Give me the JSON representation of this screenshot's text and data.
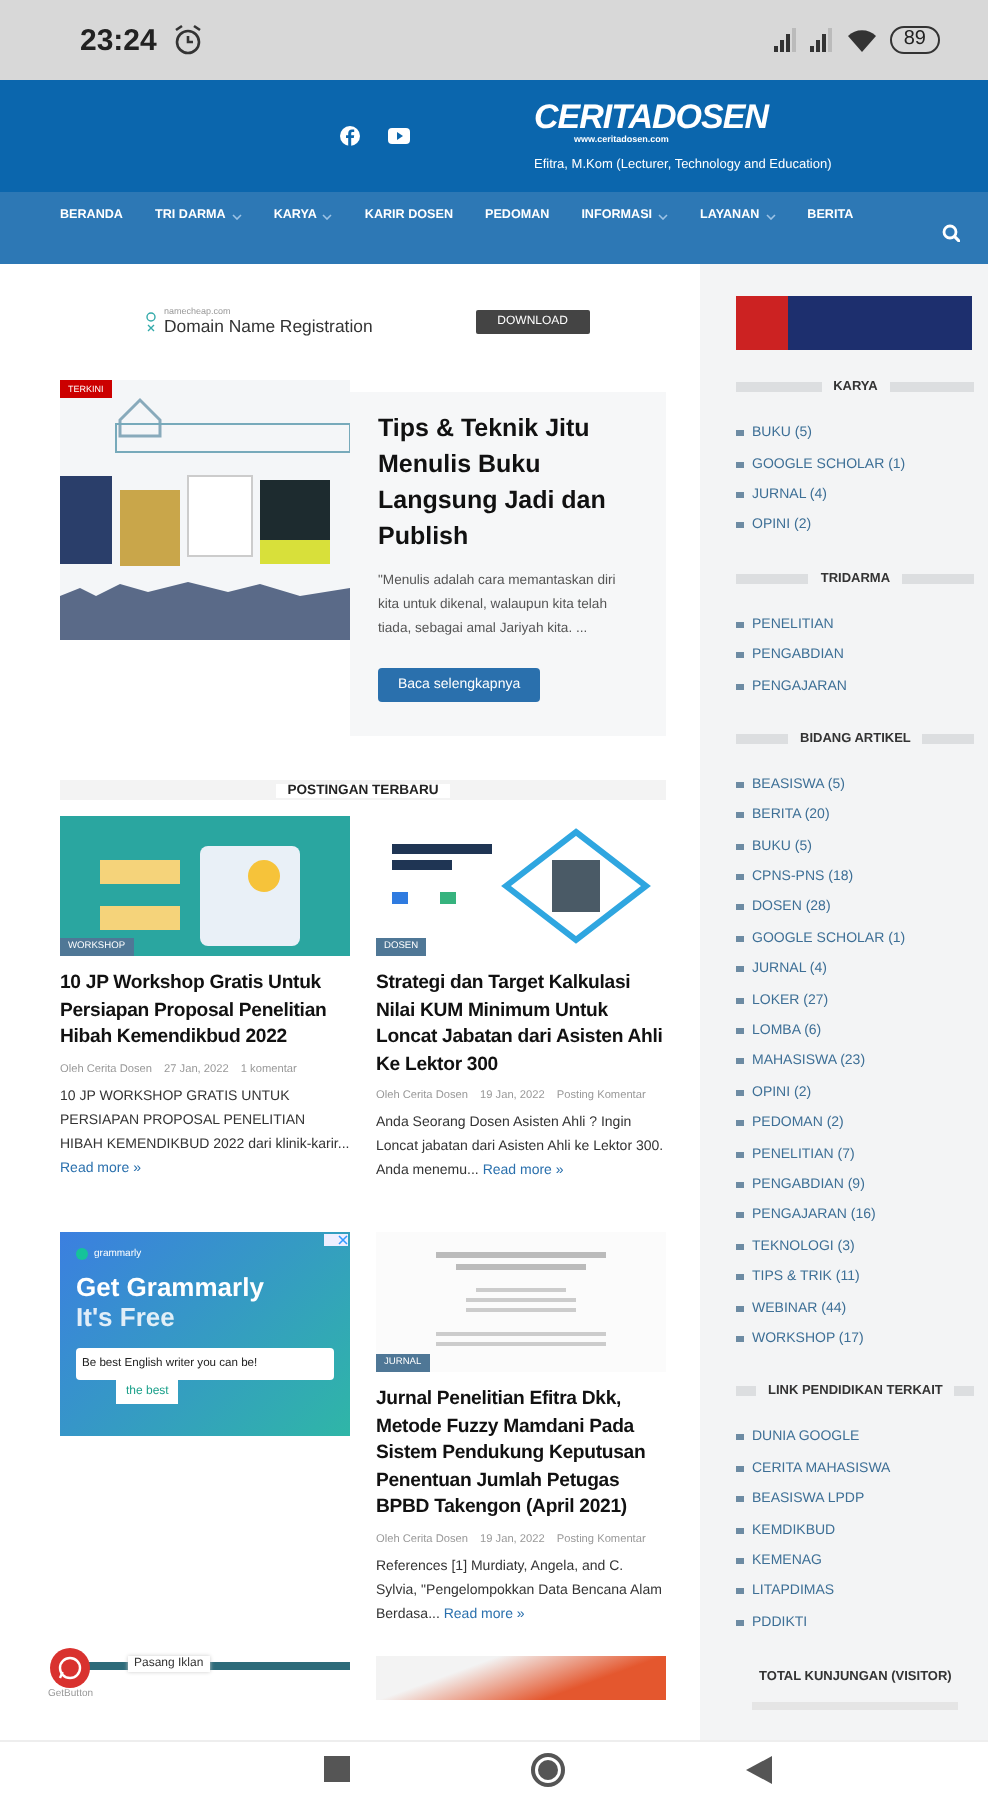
{
  "status_bar": {
    "time": "23:24",
    "battery": "89"
  },
  "header": {
    "logo": "CERITADOSEN",
    "logo_url": "www.ceritadosen.com",
    "tagline": "Efitra, M.Kom (Lecturer, Technology and Education)"
  },
  "nav": [
    {
      "label": "BERANDA",
      "dropdown": false
    },
    {
      "label": "TRI DARMA",
      "dropdown": true
    },
    {
      "label": "KARYA",
      "dropdown": true
    },
    {
      "label": "KARIR DOSEN",
      "dropdown": false
    },
    {
      "label": "PEDOMAN",
      "dropdown": false
    },
    {
      "label": "INFORMASI",
      "dropdown": true
    },
    {
      "label": "LAYANAN",
      "dropdown": true
    },
    {
      "label": "BERITA",
      "dropdown": false
    }
  ],
  "ad": {
    "source": "namecheap.com",
    "title": "Domain Name Registration",
    "button": "DOWNLOAD"
  },
  "featured": {
    "badge": "TERKINI",
    "title": "Tips & Teknik Jitu Menulis Buku Langsung Jadi dan Publish",
    "excerpt": "\"Menulis adalah cara memantaskan diri kita untuk dikenal, walaupun kita telah tiada, sebagai amal Jariyah kita. ...",
    "button": "Baca selengkapnya"
  },
  "section_title": "POSTINGAN TERBARU",
  "posts": [
    {
      "kind": "post",
      "category": "WORKSHOP",
      "title": "10 JP Workshop Gratis Untuk Persiapan Proposal Penelitian Hibah Kemendikbud 2022",
      "author": "Oleh Cerita Dosen",
      "date": "27 Jan, 2022",
      "comments": "1 komentar",
      "excerpt": "10 JP WORKSHOP GRATIS UNTUK PERSIAPAN PROPOSAL PENELITIAN HIBAH KEMENDIKBUD 2022 dari klinik-karir...",
      "read_more": "Read more »"
    },
    {
      "kind": "post",
      "category": "DOSEN",
      "title": "Strategi dan Target Kalkulasi Nilai KUM Minimum Untuk Loncat Jabatan dari Asisten Ahli Ke Lektor 300",
      "author": "Oleh Cerita Dosen",
      "date": "19 Jan, 2022",
      "comments": "Posting Komentar",
      "excerpt": "Anda Seorang Dosen Asisten Ahli ? Ingin Loncat jabatan dari Asisten Ahli ke Lektor 300. Anda menemu...",
      "read_more": "Read more »"
    },
    {
      "kind": "ad",
      "brand": "grammarly",
      "headline": "Get Grammarly",
      "subline": "It's Free",
      "sentence": "Be best English writer you can be!",
      "suggestion": "the best"
    },
    {
      "kind": "post",
      "category": "JURNAL",
      "title": "Jurnal Penelitian Efitra Dkk, Metode Fuzzy Mamdani Pada Sistem Pendukung Keputusan Penentuan Jumlah Petugas BPBD Takengon (April 2021)",
      "author": "Oleh Cerita Dosen",
      "date": "19 Jan, 2022",
      "comments": "Posting Komentar",
      "excerpt": "References [1] Murdiaty, Angela, and C. Sylvia, \"Pengelompokkan Data Bencana Alam Berdasa...",
      "read_more": "Read more »"
    }
  ],
  "chat_widget": {
    "bubble": "Pasang Iklan",
    "caption": "GetButton"
  },
  "sidebar": {
    "widgets": [
      {
        "title": "KARYA",
        "items": [
          "BUKU (5)",
          "GOOGLE SCHOLAR (1)",
          "JURNAL (4)",
          "OPINI (2)"
        ]
      },
      {
        "title": "TRIDARMA",
        "items": [
          "PENELITIAN",
          "PENGABDIAN",
          "PENGAJARAN"
        ]
      },
      {
        "title": "BIDANG ARTIKEL",
        "items": [
          "BEASISWA (5)",
          "BERITA (20)",
          "BUKU (5)",
          "CPNS-PNS (18)",
          "DOSEN (28)",
          "GOOGLE SCHOLAR (1)",
          "JURNAL (4)",
          "LOKER (27)",
          "LOMBA (6)",
          "MAHASISWA (23)",
          "OPINI (2)",
          "PEDOMAN (2)",
          "PENELITIAN (7)",
          "PENGABDIAN (9)",
          "PENGAJARAN (16)",
          "TEKNOLOGI (3)",
          "TIPS & TRIK (11)",
          "WEBINAR (44)",
          "WORKSHOP (17)"
        ]
      },
      {
        "title": "LINK PENDIDIKAN TERKAIT",
        "items": [
          "DUNIA GOOGLE",
          "CERITA MAHASISWA",
          "BEASISWA LPDP",
          "KEMDIKBUD",
          "KEMENAG",
          "LITAPDIMAS",
          "PDDIKTI"
        ]
      }
    ],
    "visitor_title": "TOTAL KUNJUNGAN (VISITOR)"
  }
}
